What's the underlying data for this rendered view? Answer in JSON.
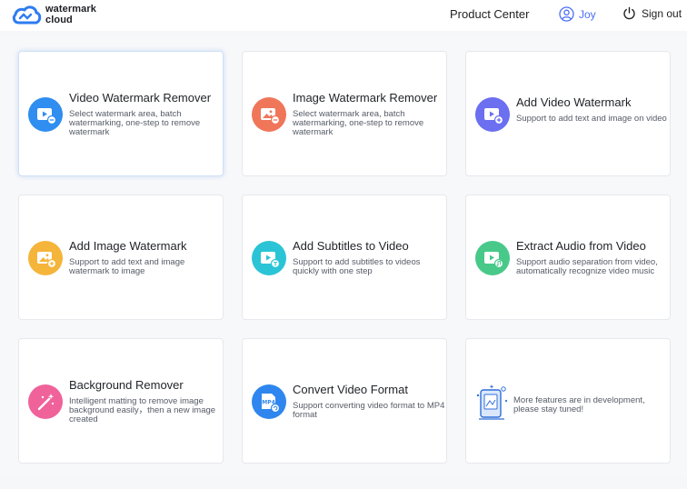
{
  "brand": {
    "line1": "watermark",
    "line2": "cloud"
  },
  "nav": {
    "product_center": "Product Center",
    "user": "Joy",
    "signout": "Sign out"
  },
  "cards": [
    {
      "title": "Video Watermark Remover",
      "desc": "Select watermark area, batch watermarking, one-step to remove watermark",
      "icon": "video-remove-icon",
      "color": "#2f8ef0"
    },
    {
      "title": "Image Watermark Remover",
      "desc": "Select watermark area, batch watermarking, one-step to remove watermark",
      "icon": "image-remove-icon",
      "color": "#f0765a"
    },
    {
      "title": "Add Video Watermark",
      "desc": "Support to add text and image on video",
      "icon": "video-add-icon",
      "color": "#6b6ff0"
    },
    {
      "title": "Add Image Watermark",
      "desc": "Support to add text and image watermark to image",
      "icon": "image-add-icon",
      "color": "#f5b53a"
    },
    {
      "title": "Add Subtitles to Video",
      "desc": "Support to add subtitles to videos quickly with one step",
      "icon": "subtitle-icon",
      "color": "#2bc4d6"
    },
    {
      "title": "Extract Audio from Video",
      "desc": "Support audio separation from video, automatically recognize video music",
      "icon": "audio-icon",
      "color": "#48c98a"
    },
    {
      "title": "Background Remover",
      "desc": "Intelligent matting to remove image background easily，then a new image created",
      "icon": "magic-wand-icon",
      "color": "#f0629a"
    },
    {
      "title": "Convert Video Format",
      "desc": "Support converting video format to MP4 format",
      "icon": "mp4-icon",
      "color": "#2f86ee",
      "badge": "MP4"
    }
  ],
  "more": {
    "text": "More features are in development, please stay tuned!"
  }
}
